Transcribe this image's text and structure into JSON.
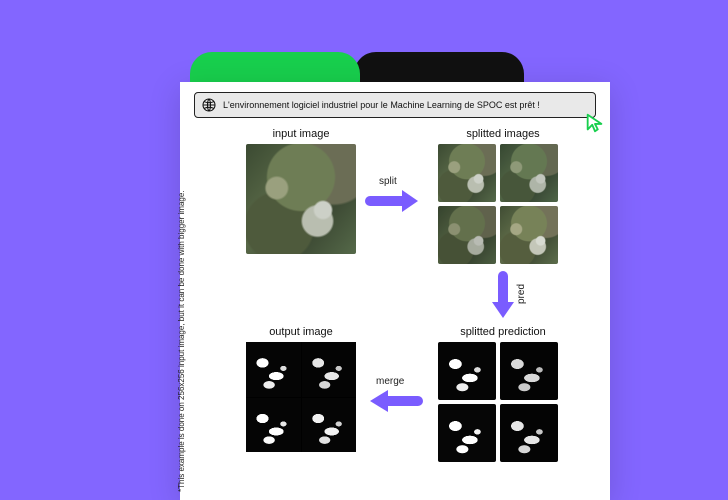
{
  "address_bar": {
    "text": "L'environnement logiciel industriel pour le Machine Learning de SPOC est prêt !"
  },
  "side_note": "*This example is done on 256x256  input image, but it can be done with bigger image.",
  "labels": {
    "input": "input image",
    "splitted_images": "splitted images",
    "splitted_pred": "splitted prediction",
    "output": "output image"
  },
  "arrows": {
    "split": "split",
    "pred": "pred",
    "merge": "merge"
  },
  "colors": {
    "accent": "#7a5cff",
    "bg": "#8366ff",
    "tab_green": "#18cf4d"
  }
}
